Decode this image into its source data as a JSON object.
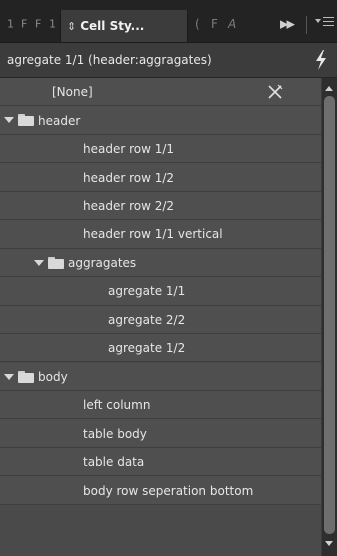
{
  "tabs": {
    "collapsed": [
      "1",
      "F",
      "F",
      "1"
    ],
    "active": {
      "label": "Cell Sty...",
      "icon": "up-down-arrows-icon"
    },
    "trailing": [
      "(",
      "F",
      "A"
    ],
    "overflow_icon": "double-chevron-right-icon",
    "menu_icon": "panel-menu-icon"
  },
  "current_style": {
    "label": "agregate 1/1 (header:aggragates)",
    "action_icon": "lightning-bolt-icon"
  },
  "styles": [
    {
      "label": "[None]",
      "type": "style",
      "level": 0,
      "icon": "clear-override-icon"
    },
    {
      "label": "header",
      "type": "group",
      "level": 0,
      "expanded": true
    },
    {
      "label": "header row 1/1",
      "type": "style",
      "level": 1
    },
    {
      "label": "header row 1/2",
      "type": "style",
      "level": 1
    },
    {
      "label": "header row 2/2",
      "type": "style",
      "level": 1
    },
    {
      "label": "header row 1/1 vertical",
      "type": "style",
      "level": 1
    },
    {
      "label": "aggragates",
      "type": "group",
      "level": 1,
      "expanded": true
    },
    {
      "label": "agregate 1/1",
      "type": "style",
      "level": 2
    },
    {
      "label": "agregate 2/2",
      "type": "style",
      "level": 2
    },
    {
      "label": "agregate 1/2",
      "type": "style",
      "level": 2
    },
    {
      "label": "body",
      "type": "group",
      "level": 0,
      "expanded": true
    },
    {
      "label": "left column",
      "type": "style",
      "level": 1
    },
    {
      "label": "table body",
      "type": "style",
      "level": 1
    },
    {
      "label": "table data",
      "type": "style",
      "level": 1
    },
    {
      "label": "body row seperation bottom",
      "type": "style",
      "level": 1
    }
  ],
  "colors": {
    "panel_bg": "#3c3c3c",
    "tabbar_bg": "#232323",
    "row_bg": "#4f4f4f",
    "row_border": "#3e3e3e",
    "text": "#e6e6e6"
  }
}
